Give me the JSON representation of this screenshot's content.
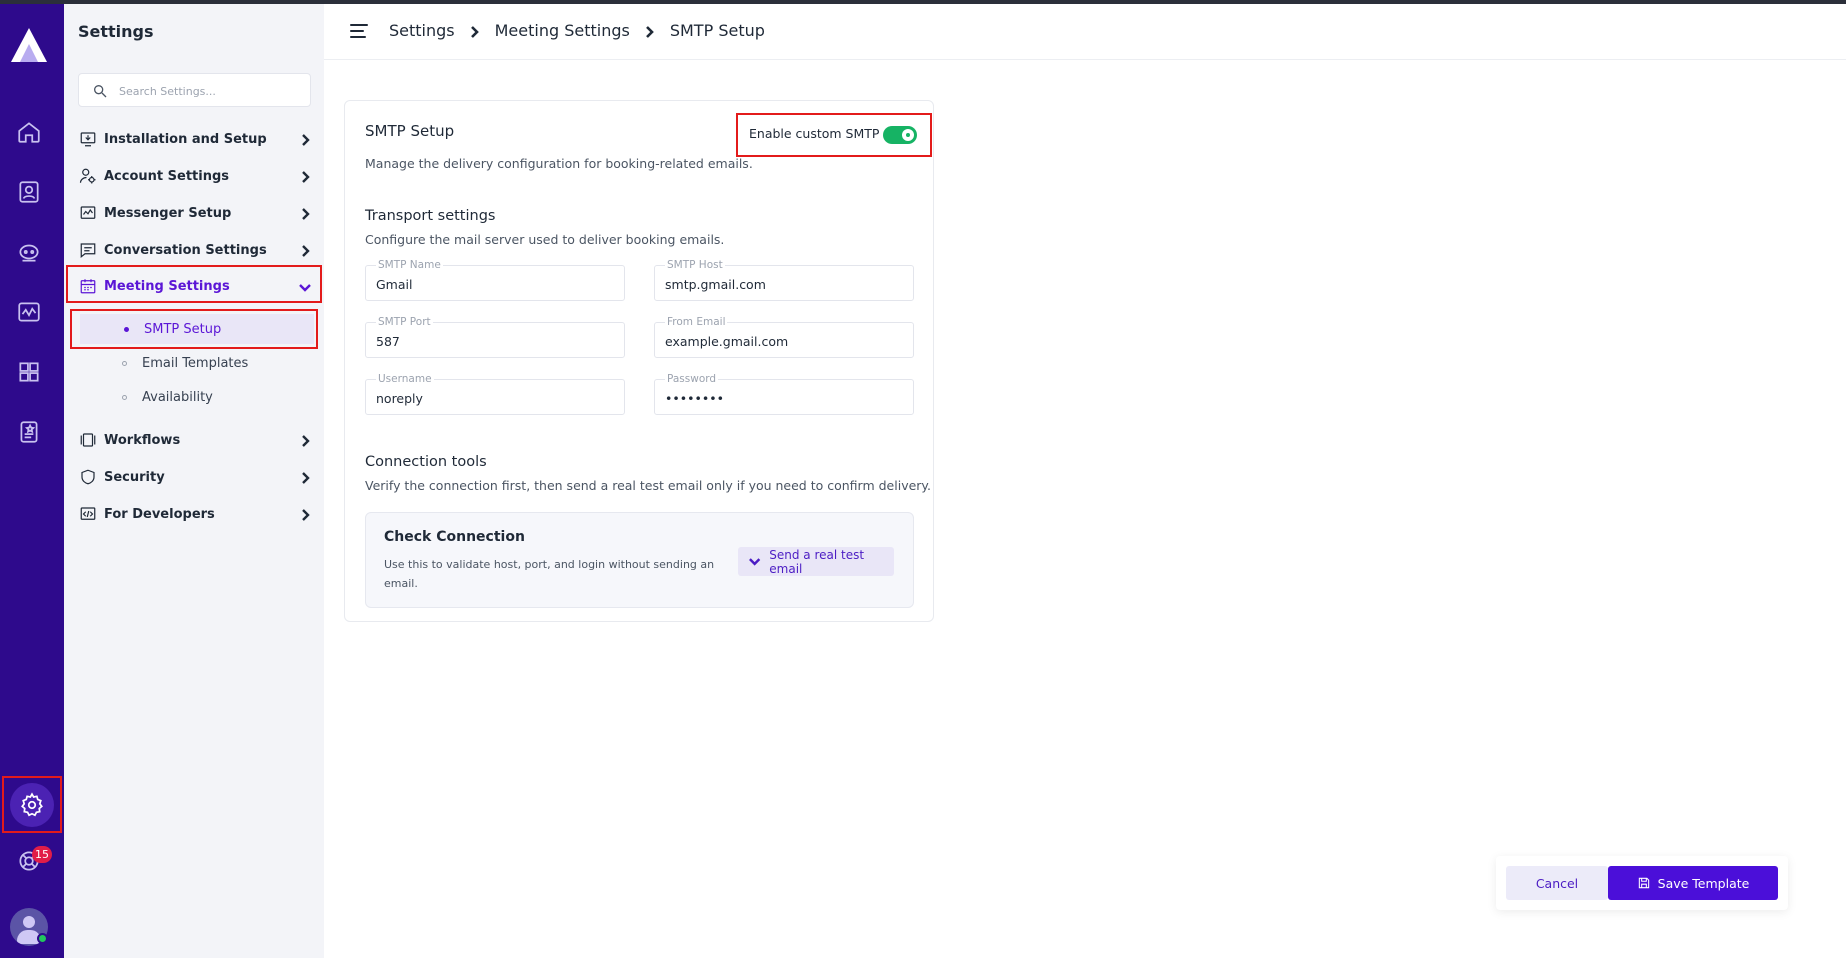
{
  "sidebar": {
    "title": "Settings",
    "search_placeholder": "Search Settings...",
    "items": [
      {
        "label": "Installation and Setup",
        "icon": "monitor-download-icon"
      },
      {
        "label": "Account Settings",
        "icon": "user-gear-icon"
      },
      {
        "label": "Messenger Setup",
        "icon": "chat-wave-icon"
      },
      {
        "label": "Conversation Settings",
        "icon": "message-lines-icon"
      },
      {
        "label": "Meeting Settings",
        "icon": "calendar-icon",
        "expanded": true
      },
      {
        "label": "Workflows",
        "icon": "workflow-icon"
      },
      {
        "label": "Security",
        "icon": "shield-icon"
      },
      {
        "label": "For Developers",
        "icon": "code-icon"
      }
    ],
    "meeting_subitems": [
      {
        "label": "SMTP Setup",
        "active": true
      },
      {
        "label": "Email Templates",
        "active": false
      },
      {
        "label": "Availability",
        "active": false
      }
    ]
  },
  "rail": {
    "icons": [
      "home-icon",
      "contacts-icon",
      "bot-icon",
      "analytics-icon",
      "apps-icon",
      "notes-icon",
      "settings-gear-icon",
      "support-icon"
    ],
    "notification_count": "15"
  },
  "header": {
    "breadcrumb": [
      "Settings",
      "Meeting Settings",
      "SMTP Setup"
    ]
  },
  "card": {
    "title": "SMTP Setup",
    "description": "Manage the delivery configuration for booking-related emails.",
    "toggle_label": "Enable custom SMTP",
    "toggle_on": true,
    "transport": {
      "title": "Transport settings",
      "description": "Configure the mail server used to deliver booking emails.",
      "fields": [
        {
          "label": "SMTP Name",
          "value": "Gmail"
        },
        {
          "label": "SMTP Host",
          "value": "smtp.gmail.com"
        },
        {
          "label": "SMTP Port",
          "value": "587"
        },
        {
          "label": "From Email",
          "value": "example.gmail.com"
        },
        {
          "label": "Username",
          "value": "noreply"
        },
        {
          "label": "Password",
          "value": "••••••••"
        }
      ]
    },
    "connection": {
      "title": "Connection tools",
      "description": "Verify the connection first, then send a real test email only if you need to confirm delivery.",
      "check_title": "Check Connection",
      "check_description": "Use this to validate host, port, and login without sending an email.",
      "send_test_label": "Send a real test email"
    }
  },
  "actions": {
    "cancel_label": "Cancel",
    "save_label": "Save Template"
  },
  "colors": {
    "rail": "#2e0a8c",
    "accent": "#4b0fd9",
    "toggle": "#16b364",
    "highlight_border": "#e31b1b"
  }
}
